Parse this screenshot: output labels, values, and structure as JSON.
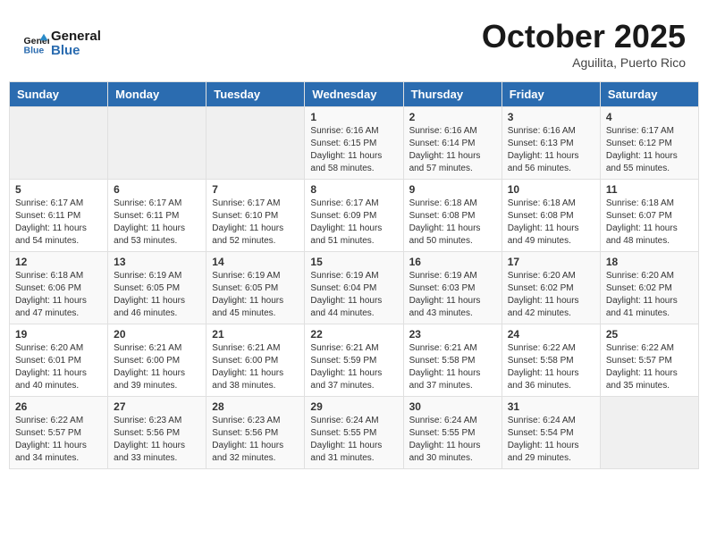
{
  "header": {
    "logo_general": "General",
    "logo_blue": "Blue",
    "month": "October 2025",
    "location": "Aguilita, Puerto Rico"
  },
  "weekdays": [
    "Sunday",
    "Monday",
    "Tuesday",
    "Wednesday",
    "Thursday",
    "Friday",
    "Saturday"
  ],
  "weeks": [
    [
      {
        "day": "",
        "info": ""
      },
      {
        "day": "",
        "info": ""
      },
      {
        "day": "",
        "info": ""
      },
      {
        "day": "1",
        "info": "Sunrise: 6:16 AM\nSunset: 6:15 PM\nDaylight: 11 hours\nand 58 minutes."
      },
      {
        "day": "2",
        "info": "Sunrise: 6:16 AM\nSunset: 6:14 PM\nDaylight: 11 hours\nand 57 minutes."
      },
      {
        "day": "3",
        "info": "Sunrise: 6:16 AM\nSunset: 6:13 PM\nDaylight: 11 hours\nand 56 minutes."
      },
      {
        "day": "4",
        "info": "Sunrise: 6:17 AM\nSunset: 6:12 PM\nDaylight: 11 hours\nand 55 minutes."
      }
    ],
    [
      {
        "day": "5",
        "info": "Sunrise: 6:17 AM\nSunset: 6:11 PM\nDaylight: 11 hours\nand 54 minutes."
      },
      {
        "day": "6",
        "info": "Sunrise: 6:17 AM\nSunset: 6:11 PM\nDaylight: 11 hours\nand 53 minutes."
      },
      {
        "day": "7",
        "info": "Sunrise: 6:17 AM\nSunset: 6:10 PM\nDaylight: 11 hours\nand 52 minutes."
      },
      {
        "day": "8",
        "info": "Sunrise: 6:17 AM\nSunset: 6:09 PM\nDaylight: 11 hours\nand 51 minutes."
      },
      {
        "day": "9",
        "info": "Sunrise: 6:18 AM\nSunset: 6:08 PM\nDaylight: 11 hours\nand 50 minutes."
      },
      {
        "day": "10",
        "info": "Sunrise: 6:18 AM\nSunset: 6:08 PM\nDaylight: 11 hours\nand 49 minutes."
      },
      {
        "day": "11",
        "info": "Sunrise: 6:18 AM\nSunset: 6:07 PM\nDaylight: 11 hours\nand 48 minutes."
      }
    ],
    [
      {
        "day": "12",
        "info": "Sunrise: 6:18 AM\nSunset: 6:06 PM\nDaylight: 11 hours\nand 47 minutes."
      },
      {
        "day": "13",
        "info": "Sunrise: 6:19 AM\nSunset: 6:05 PM\nDaylight: 11 hours\nand 46 minutes."
      },
      {
        "day": "14",
        "info": "Sunrise: 6:19 AM\nSunset: 6:05 PM\nDaylight: 11 hours\nand 45 minutes."
      },
      {
        "day": "15",
        "info": "Sunrise: 6:19 AM\nSunset: 6:04 PM\nDaylight: 11 hours\nand 44 minutes."
      },
      {
        "day": "16",
        "info": "Sunrise: 6:19 AM\nSunset: 6:03 PM\nDaylight: 11 hours\nand 43 minutes."
      },
      {
        "day": "17",
        "info": "Sunrise: 6:20 AM\nSunset: 6:02 PM\nDaylight: 11 hours\nand 42 minutes."
      },
      {
        "day": "18",
        "info": "Sunrise: 6:20 AM\nSunset: 6:02 PM\nDaylight: 11 hours\nand 41 minutes."
      }
    ],
    [
      {
        "day": "19",
        "info": "Sunrise: 6:20 AM\nSunset: 6:01 PM\nDaylight: 11 hours\nand 40 minutes."
      },
      {
        "day": "20",
        "info": "Sunrise: 6:21 AM\nSunset: 6:00 PM\nDaylight: 11 hours\nand 39 minutes."
      },
      {
        "day": "21",
        "info": "Sunrise: 6:21 AM\nSunset: 6:00 PM\nDaylight: 11 hours\nand 38 minutes."
      },
      {
        "day": "22",
        "info": "Sunrise: 6:21 AM\nSunset: 5:59 PM\nDaylight: 11 hours\nand 37 minutes."
      },
      {
        "day": "23",
        "info": "Sunrise: 6:21 AM\nSunset: 5:58 PM\nDaylight: 11 hours\nand 37 minutes."
      },
      {
        "day": "24",
        "info": "Sunrise: 6:22 AM\nSunset: 5:58 PM\nDaylight: 11 hours\nand 36 minutes."
      },
      {
        "day": "25",
        "info": "Sunrise: 6:22 AM\nSunset: 5:57 PM\nDaylight: 11 hours\nand 35 minutes."
      }
    ],
    [
      {
        "day": "26",
        "info": "Sunrise: 6:22 AM\nSunset: 5:57 PM\nDaylight: 11 hours\nand 34 minutes."
      },
      {
        "day": "27",
        "info": "Sunrise: 6:23 AM\nSunset: 5:56 PM\nDaylight: 11 hours\nand 33 minutes."
      },
      {
        "day": "28",
        "info": "Sunrise: 6:23 AM\nSunset: 5:56 PM\nDaylight: 11 hours\nand 32 minutes."
      },
      {
        "day": "29",
        "info": "Sunrise: 6:24 AM\nSunset: 5:55 PM\nDaylight: 11 hours\nand 31 minutes."
      },
      {
        "day": "30",
        "info": "Sunrise: 6:24 AM\nSunset: 5:55 PM\nDaylight: 11 hours\nand 30 minutes."
      },
      {
        "day": "31",
        "info": "Sunrise: 6:24 AM\nSunset: 5:54 PM\nDaylight: 11 hours\nand 29 minutes."
      },
      {
        "day": "",
        "info": ""
      }
    ]
  ]
}
